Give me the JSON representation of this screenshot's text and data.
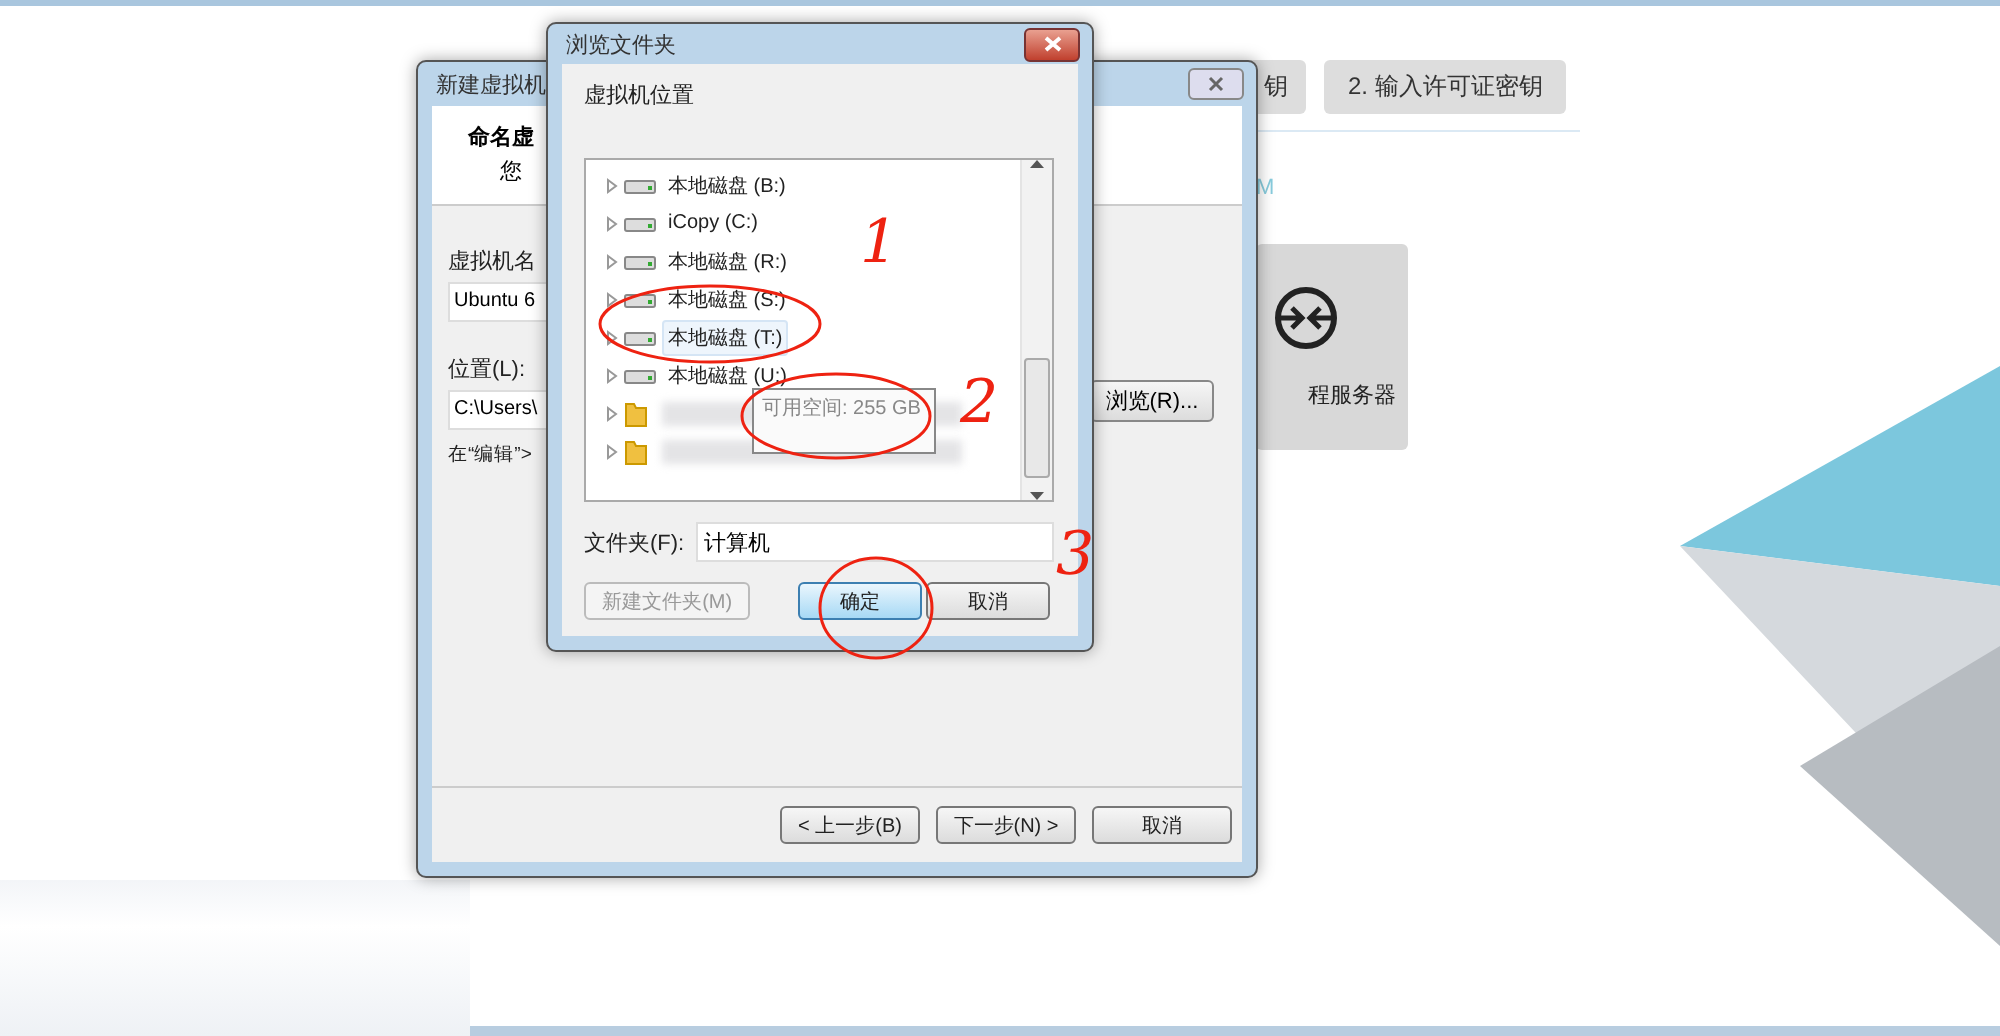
{
  "background_app": {
    "steps": [
      {
        "label": "钥",
        "selected": false
      },
      {
        "label": "2. 输入许可证密钥",
        "selected": false
      }
    ],
    "section_letter": "M",
    "card": {
      "label": "程服务器"
    }
  },
  "wizard": {
    "title": "新建虚拟机",
    "heading": "命名虚",
    "subheading": "您",
    "name_label": "虚拟机名",
    "name_value": "Ubuntu 6",
    "location_label": "位置(L):",
    "location_value": "C:\\Users\\",
    "hint": "在“编辑”>",
    "browse_button": "浏览(R)...",
    "buttons": [
      "< 上一步(B)",
      "下一步(N) >",
      "取消"
    ]
  },
  "browse_dialog": {
    "title": "浏览文件夹",
    "prompt": "虚拟机位置",
    "tree": [
      {
        "label": "本地磁盘 (B:)",
        "kind": "drive",
        "selected": false
      },
      {
        "label": "iCopy (C:)",
        "kind": "drive",
        "selected": false
      },
      {
        "label": "本地磁盘 (R:)",
        "kind": "drive",
        "selected": false
      },
      {
        "label": "本地磁盘 (S:)",
        "kind": "drive",
        "selected": false
      },
      {
        "label": "本地磁盘 (T:)",
        "kind": "drive",
        "selected": true
      },
      {
        "label": "本地磁盘 (U:)",
        "kind": "drive",
        "selected": false
      },
      {
        "kind": "folder",
        "selected": false
      },
      {
        "kind": "folder",
        "selected": false
      }
    ],
    "tooltip": "可用空间: 255 GB",
    "folder_label": "文件夹(F):",
    "folder_value": "计算机",
    "buttons": [
      {
        "label": "新建文件夹(M)",
        "disabled": true,
        "default": false
      },
      {
        "label": "确定",
        "disabled": false,
        "default": true
      },
      {
        "label": "取消",
        "disabled": false,
        "default": false
      }
    ]
  },
  "annotations": [
    {
      "kind": "circle"
    },
    {
      "kind": "number",
      "text": "1"
    },
    {
      "kind": "circle"
    },
    {
      "kind": "number",
      "text": "2"
    },
    {
      "kind": "number",
      "text": "3"
    },
    {
      "kind": "circle"
    }
  ]
}
